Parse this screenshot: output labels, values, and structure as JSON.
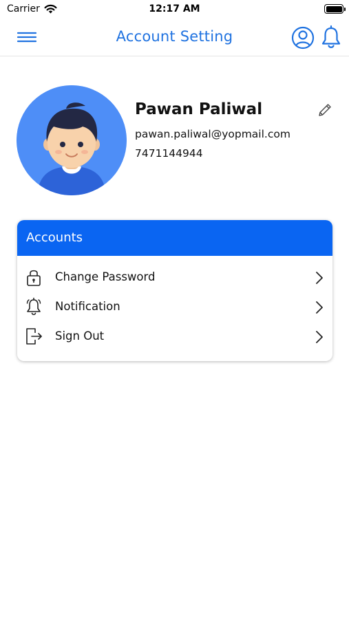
{
  "status_bar": {
    "carrier": "Carrier",
    "time": "12:17 AM",
    "wifi_icon": "wifi-icon",
    "battery_icon": "battery-icon"
  },
  "header": {
    "title": "Account Setting",
    "menu_icon": "hamburger-menu-icon",
    "profile_icon": "user-circle-icon",
    "notification_icon": "bell-icon",
    "accent_color": "#1f72e0"
  },
  "profile": {
    "name": "Pawan Paliwal",
    "email": "pawan.paliwal@yopmail.com",
    "phone": "7471144944",
    "avatar_icon": "avatar-illustration",
    "edit_icon": "pencil-icon"
  },
  "accounts": {
    "title": "Accounts",
    "header_color": "#0a65f2",
    "items": [
      {
        "label": "Change Password",
        "icon": "lock-icon"
      },
      {
        "label": "Notification",
        "icon": "bell-icon"
      },
      {
        "label": "Sign Out",
        "icon": "sign-out-icon"
      }
    ]
  }
}
